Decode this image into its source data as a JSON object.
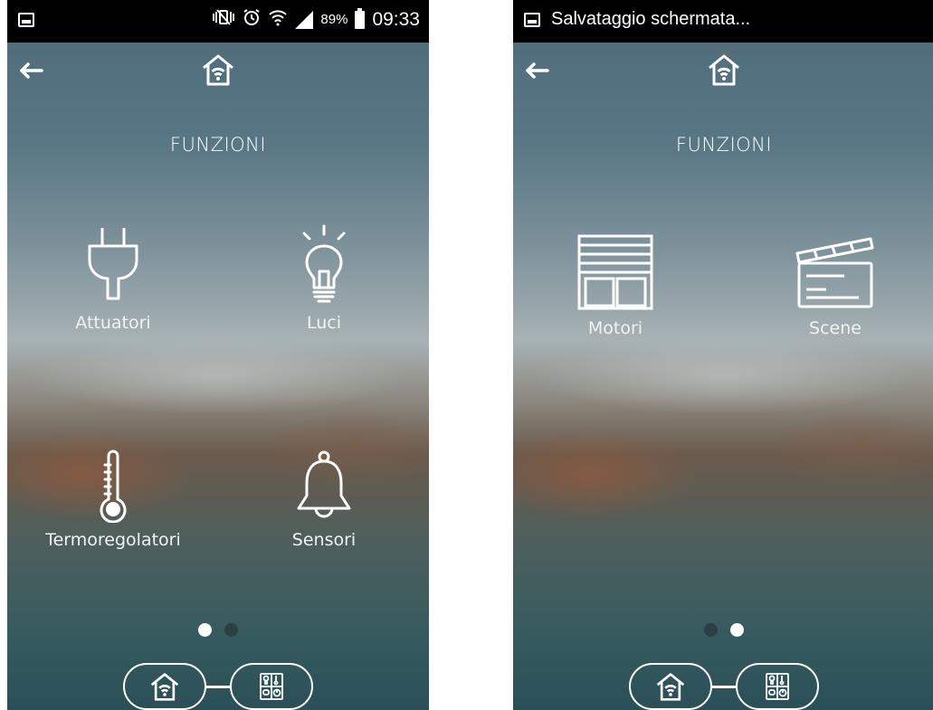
{
  "screens": [
    {
      "statusbar": {
        "left_icon": "image-icon",
        "title": "",
        "battery": "89%",
        "time": "09:33",
        "icons": [
          "mute-vibrate-icon",
          "alarm-icon",
          "wifi-icon",
          "signal-icon",
          "battery-icon"
        ]
      },
      "header": {
        "back_icon": "back-arrow-icon",
        "home_icon": "home-wifi-icon"
      },
      "title": "FUNZIONI",
      "tiles": [
        {
          "label": "Attuatori",
          "icon": "plug-icon"
        },
        {
          "label": "Luci",
          "icon": "bulb-icon"
        },
        {
          "label": "Termoregolatori",
          "icon": "thermometer-icon"
        },
        {
          "label": "Sensori",
          "icon": "bell-icon"
        }
      ],
      "pagination": {
        "pages": 2,
        "active": 1
      },
      "bottom_nav": [
        "home-wifi-icon",
        "control-panel-icon"
      ]
    },
    {
      "statusbar": {
        "left_icon": "image-icon",
        "title": "Salvataggio schermata...",
        "battery": "",
        "time": ""
      },
      "header": {
        "back_icon": "back-arrow-icon",
        "home_icon": "home-wifi-icon"
      },
      "title": "FUNZIONI",
      "tiles": [
        {
          "label": "Motori",
          "icon": "shutter-icon"
        },
        {
          "label": "Scene",
          "icon": "clapperboard-icon"
        }
      ],
      "pagination": {
        "pages": 2,
        "active": 2
      },
      "bottom_nav": [
        "home-wifi-icon",
        "control-panel-icon"
      ]
    }
  ],
  "colors": {
    "statusbar": "#000000",
    "dot_inactive": "#2c3f45",
    "icon": "#ffffff"
  }
}
